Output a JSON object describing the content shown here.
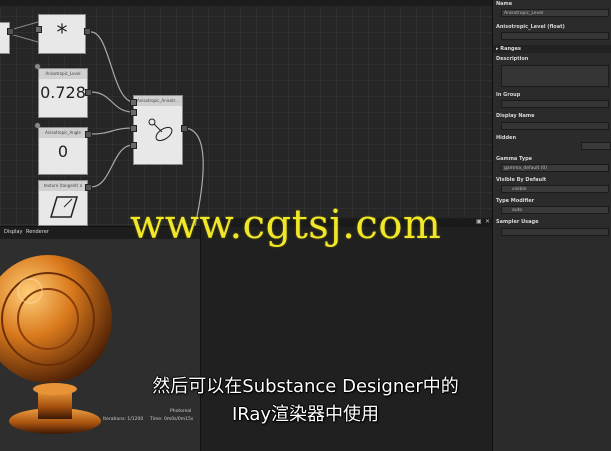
{
  "nodes": {
    "multiply": {
      "symbol": "*"
    },
    "anisotropic_level": {
      "title": "Anisotropic_Level",
      "value": "0.728"
    },
    "anisotropic_angle": {
      "title": "Anisotropic_Angle",
      "value": "0"
    },
    "texture_tangent": {
      "title": "texture (tangent) n"
    },
    "anisotropic_output": {
      "title": "Anisotropic_Anisotr..."
    }
  },
  "properties": {
    "name_label": "Name",
    "name_value": "Anisotropic_Level",
    "type_label": "Anisotropic_Level (float)",
    "ranges_label": "Ranges",
    "description_label": "Description",
    "group_label": "In Group",
    "display_name_label": "Display Name",
    "hidden_label": "Hidden",
    "gamma_type_label": "Gamma Type",
    "gamma_type_value": "gamma_default (0)",
    "visible_default_label": "Visible By Default",
    "visible_default_value": "visible",
    "type_modifier_label": "Type Modifier",
    "type_modifier_value": "auto",
    "sampler_usage_label": "Sampler Usage"
  },
  "display": {
    "tab_display": "Display",
    "tab_renderer": "Renderer",
    "render_mode": "Photoreal",
    "iterations": "Iterations: 1/1200",
    "time": "Time: 0m0s/0m15s"
  },
  "watermark": "www.cgtsj.com",
  "subtitle": {
    "line1": "然后可以在Substance Designer中的",
    "line2": "IRay渲染器中使用"
  },
  "colors": {
    "watermark": "#f0e62a",
    "render_orange": "#d9791c"
  }
}
